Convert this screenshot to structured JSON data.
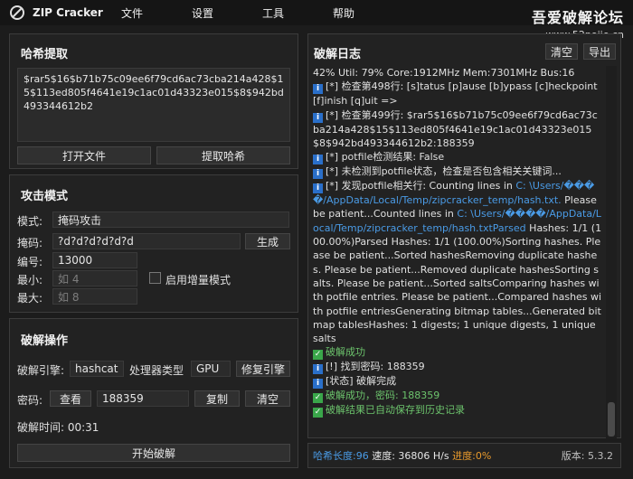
{
  "app": {
    "title": "ZIP Cracker"
  },
  "menu": [
    "文件",
    "设置",
    "工具",
    "帮助"
  ],
  "watermark": {
    "main": "吾爱破解论坛",
    "url": "www.52pojie.cn"
  },
  "hash_panel": {
    "title": "哈希提取",
    "hash_value": "$rar5$16$b71b75c09ee6f79cd6ac73cba214a428$15$113ed805f4641e19c1ac01d43323e015$8$942bd493344612b2",
    "open_file_label": "打开文件",
    "extract_label": "提取哈希"
  },
  "attack_panel": {
    "title": "攻击模式",
    "mode_label": "模式:",
    "mode_value": "掩码攻击",
    "mask_label": "掩码:",
    "mask_value": "?d?d?d?d?d?d",
    "generate_label": "生成",
    "charset_label": "编号:",
    "charset_value": "13000",
    "min_label": "最小:",
    "min_placeholder": "如 4",
    "max_label": "最大:",
    "max_placeholder": "如 8",
    "increment_label": "启用增量模式",
    "increment_checked": false
  },
  "crack_panel": {
    "title": "破解操作",
    "engine_label": "破解引擎:",
    "engine_value": "hashcat",
    "processor_label": "处理器类型",
    "processor_value": "GPU",
    "repair_label": "修复引擎",
    "password_label": "密码:",
    "view_label": "查看",
    "password_value": "188359",
    "copy_label": "复制",
    "clear_label": "清空",
    "time_label": "破解时间: 00:31",
    "start_label": "开始破解"
  },
  "log_panel": {
    "title": "破解日志",
    "clear_label": "清空",
    "export_label": "导出"
  },
  "log": {
    "l0": "42% Util: 79% Core:1912MHz Mem:7301MHz Bus:16",
    "l1": "[*] 检查第498行: [s]tatus [p]ause [b]ypass [c]heckpoint [f]inish [q]uit =>",
    "l2": "[*] 检查第499行: $rar5$16$b71b75c09ee6f79cd6ac73cba214a428$15$113ed805f4641e19c1ac01d43323e015$8$942bd493344612b2:188359",
    "l3": "[*] potfile检测结果: False",
    "l4": "[*] 未检测到potfile状态，检查是否包含相关关键词...",
    "l5a": "[*] 发现potfile相关行: Counting lines in ",
    "l5b": "C: \\Users/����/AppData/Local/Temp/zipcracker_temp/hash.txt.",
    "l5c": " Please be patient...Counted lines in ",
    "l5d": "C: \\Users/����/AppData/Local/Temp/zipcracker_temp/hash.txtParsed",
    "l5e": " Hashes: 1/1 (100.00%)Parsed Hashes: 1/1 (100.00%)Sorting hashes. Please be patient...Sorted hashesRemoving duplicate hashes. Please be patient...Removed duplicate hashesSorting salts. Please be patient...Sorted saltsComparing hashes with potfile entries. Please be patient...Compared hashes with potfile entriesGenerating bitmap tables...Generated bitmap tablesHashes: 1 digests; 1 unique digests, 1 unique salts",
    "l6": "破解成功",
    "l7": "[!] 找到密码: 188359",
    "l8": "[状态] 破解完成",
    "l9": "破解成功，密码: 188359",
    "l10": "破解结果已自动保存到历史记录"
  },
  "status": {
    "hash_len_label": "哈希长度: ",
    "hash_len": "96",
    "speed": " 速度: 36806 H/s ",
    "progress_label": "进度: ",
    "progress": "0%",
    "version": "版本: 5.3.2"
  },
  "colors": {
    "accent": "#4a9be6",
    "success": "#3aa64a",
    "warning": "#e89a2c",
    "bg": "#1c1c1c"
  }
}
